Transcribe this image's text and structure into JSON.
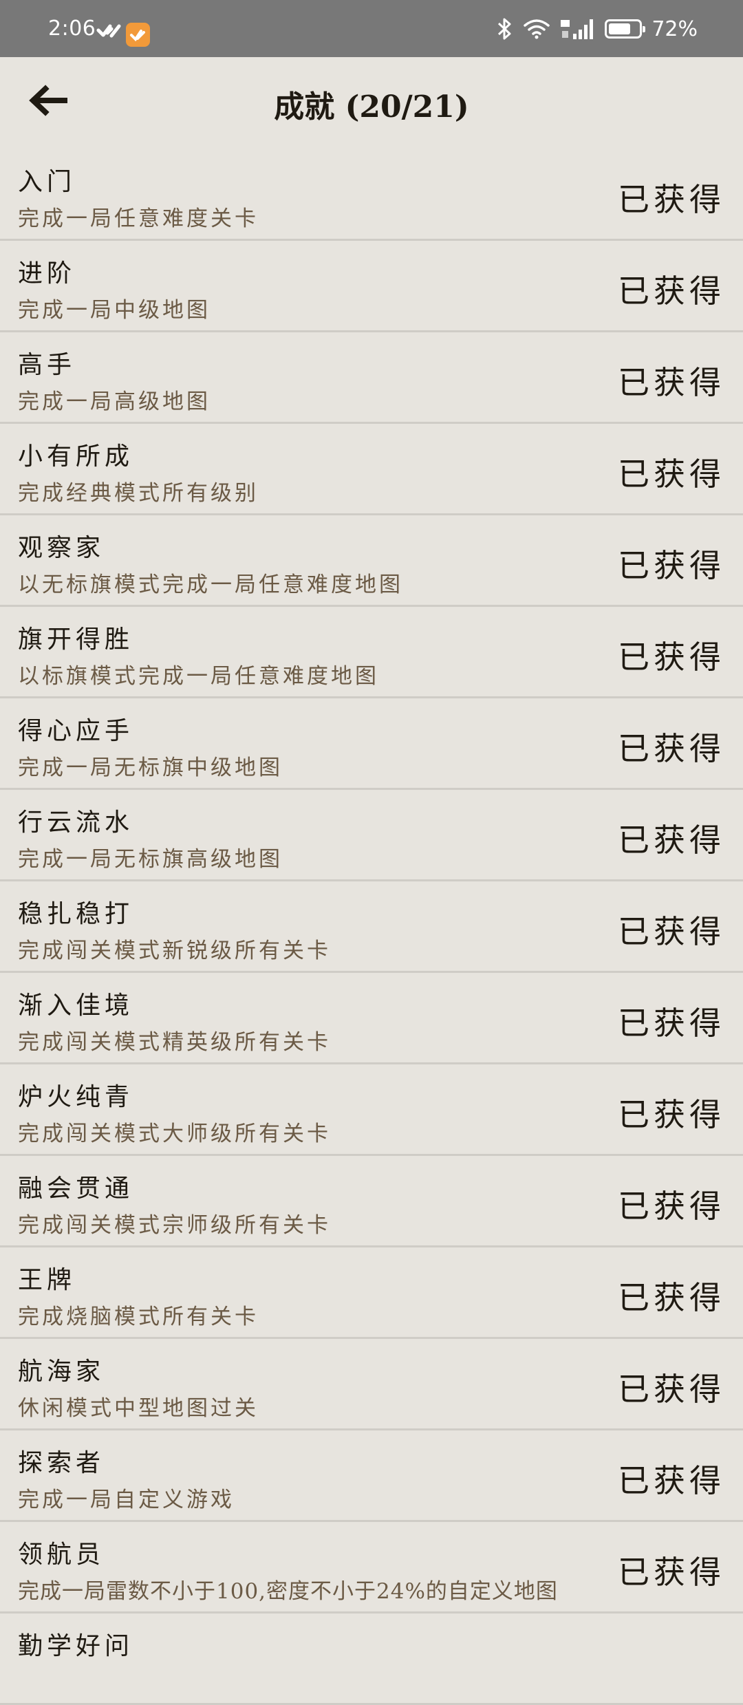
{
  "status_bar": {
    "time": "2:06",
    "battery": "72%",
    "battery_level": 0.72
  },
  "header": {
    "title": "成就 (20/21)"
  },
  "achievements": [
    {
      "name": "入门",
      "desc": "完成一局任意难度关卡",
      "status": "已获得"
    },
    {
      "name": "进阶",
      "desc": "完成一局中级地图",
      "status": "已获得"
    },
    {
      "name": "高手",
      "desc": "完成一局高级地图",
      "status": "已获得"
    },
    {
      "name": "小有所成",
      "desc": "完成经典模式所有级别",
      "status": "已获得"
    },
    {
      "name": "观察家",
      "desc": "以无标旗模式完成一局任意难度地图",
      "status": "已获得"
    },
    {
      "name": "旗开得胜",
      "desc": "以标旗模式完成一局任意难度地图",
      "status": "已获得"
    },
    {
      "name": "得心应手",
      "desc": "完成一局无标旗中级地图",
      "status": "已获得"
    },
    {
      "name": "行云流水",
      "desc": "完成一局无标旗高级地图",
      "status": "已获得"
    },
    {
      "name": "稳扎稳打",
      "desc": "完成闯关模式新锐级所有关卡",
      "status": "已获得"
    },
    {
      "name": "渐入佳境",
      "desc": "完成闯关模式精英级所有关卡",
      "status": "已获得"
    },
    {
      "name": "炉火纯青",
      "desc": "完成闯关模式大师级所有关卡",
      "status": "已获得"
    },
    {
      "name": "融会贯通",
      "desc": "完成闯关模式宗师级所有关卡",
      "status": "已获得"
    },
    {
      "name": "王牌",
      "desc": "完成烧脑模式所有关卡",
      "status": "已获得"
    },
    {
      "name": "航海家",
      "desc": "休闲模式中型地图过关",
      "status": "已获得"
    },
    {
      "name": "探索者",
      "desc": "完成一局自定义游戏",
      "status": "已获得"
    },
    {
      "name": "领航员",
      "desc": "完成一局雷数不小于100,密度不小于24%的自定义地图",
      "status": "已获得"
    },
    {
      "name": "勤学好问",
      "desc": "",
      "status": ""
    }
  ]
}
